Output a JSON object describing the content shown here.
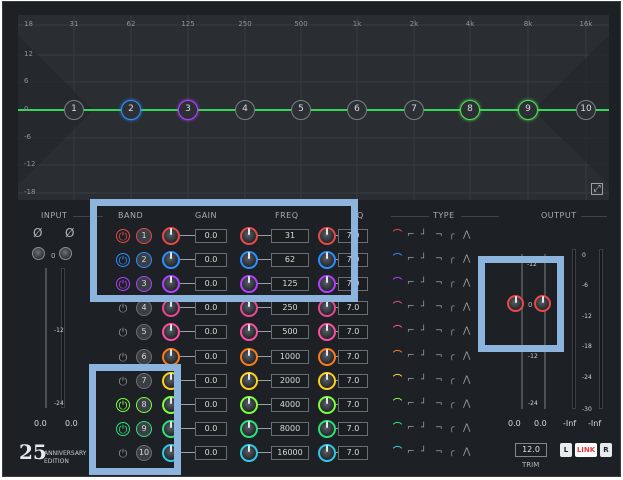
{
  "graph": {
    "freq_labels": [
      "31",
      "62",
      "125",
      "250",
      "500",
      "1k",
      "2k",
      "4k",
      "8k",
      "16k"
    ],
    "db_labels": [
      "18",
      "12",
      "6",
      "0",
      "-6",
      "-12",
      "-18"
    ],
    "nodes": [
      {
        "label": "1",
        "color": "#7a8087"
      },
      {
        "label": "2",
        "color": "#2f8cff"
      },
      {
        "label": "3",
        "color": "#b040ff"
      },
      {
        "label": "4",
        "color": "#7a8087"
      },
      {
        "label": "5",
        "color": "#7a8087"
      },
      {
        "label": "6",
        "color": "#7a8087"
      },
      {
        "label": "7",
        "color": "#7a8087"
      },
      {
        "label": "8",
        "color": "#4de04d"
      },
      {
        "label": "9",
        "color": "#4de04d"
      },
      {
        "label": "10",
        "color": "#7a8087"
      }
    ],
    "curve_color": "#33d655",
    "expand_icon": "expand-icon"
  },
  "headers": {
    "input": "INPUT",
    "band": "BAND",
    "gain": "GAIN",
    "freq": "FREQ",
    "q": "Q",
    "type": "TYPE",
    "output": "OUTPUT"
  },
  "input": {
    "phase_left": "Ø",
    "phase_right": "Ø",
    "balance_label": "0",
    "scale_a": "-12",
    "scale_b": "-24",
    "value_left": "0.0",
    "value_right": "0.0"
  },
  "output": {
    "scale": [
      "0",
      "-6",
      "-12",
      "-18",
      "-24",
      "-30"
    ],
    "left_scale_a": "-12",
    "left_scale_b": "-12",
    "left_scale_c": "-24",
    "balance_label": "0",
    "value_a": "0.0",
    "value_b": "0.0",
    "value_c": "-Inf",
    "value_d": "-Inf"
  },
  "bands": [
    {
      "num": "1",
      "gain": "0.0",
      "freq": "31",
      "q": "7.0",
      "accent": "#e84848"
    },
    {
      "num": "2",
      "gain": "0.0",
      "freq": "62",
      "q": "7.0",
      "accent": "#2f8cff"
    },
    {
      "num": "3",
      "gain": "0.0",
      "freq": "125",
      "q": "7.0",
      "accent": "#b040ff"
    },
    {
      "num": "4",
      "gain": "0.0",
      "freq": "250",
      "q": "7.0",
      "accent": "#e84890"
    },
    {
      "num": "5",
      "gain": "0.0",
      "freq": "500",
      "q": "7.0",
      "accent": "#ff4fa0"
    },
    {
      "num": "6",
      "gain": "0.0",
      "freq": "1000",
      "q": "7.0",
      "accent": "#ff7a1a"
    },
    {
      "num": "7",
      "gain": "0.0",
      "freq": "2000",
      "q": "7.0",
      "accent": "#ffd21a"
    },
    {
      "num": "8",
      "gain": "0.0",
      "freq": "4000",
      "q": "7.0",
      "accent": "#7cff3c"
    },
    {
      "num": "9",
      "gain": "0.0",
      "freq": "8000",
      "q": "7.0",
      "accent": "#2ee07a"
    },
    {
      "num": "10",
      "gain": "0.0",
      "freq": "16000",
      "q": "7.0",
      "accent": "#2ecbe6"
    }
  ],
  "filter_types": [
    "bell",
    "low-shelf",
    "high-shelf",
    "low-cut",
    "high-cut",
    "notch"
  ],
  "filter_glyphs": [
    "⌒",
    "⌐",
    "┘",
    "¬",
    "╭",
    "⋀"
  ],
  "footer": {
    "logo_num": "25",
    "logo_line1": "ANNIVERSARY",
    "logo_line2": "EDITION",
    "trim_value": "12.0",
    "trim_label": "TRIM",
    "btn_l": "L",
    "btn_link": "LINK",
    "btn_r": "R"
  },
  "overlay_color": "#8db4dc"
}
